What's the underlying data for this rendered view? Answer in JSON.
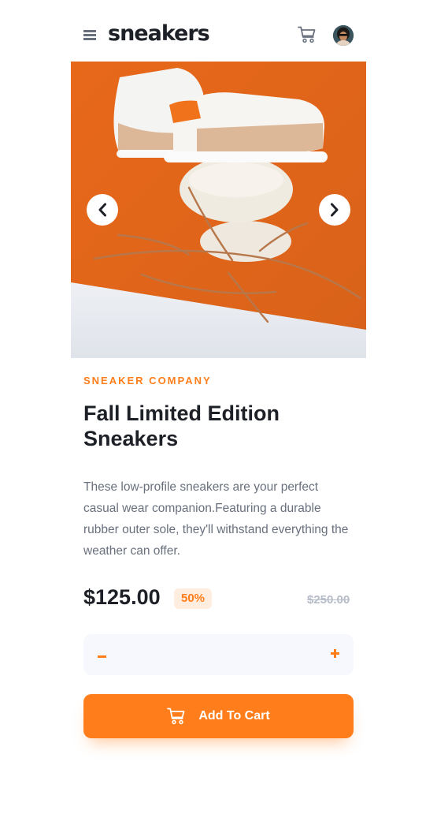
{
  "header": {
    "logo": "sneakers"
  },
  "product": {
    "company": "SNEAKER COMPANY",
    "title": "Fall Limited Edition Sneakers",
    "description": "These low-profile sneakers are your perfect casual wear companion.Featuring a durable rubber outer sole, they'll withstand everything the weather can offer.",
    "price": "$125.00",
    "discount": "50%",
    "old_price": "$250.00"
  },
  "quantity": {
    "value": ""
  },
  "cart_button": {
    "label": "Add To Cart"
  },
  "icons": {
    "menu": "menu-icon",
    "cart": "cart-icon",
    "prev": "chevron-left-icon",
    "next": "chevron-right-icon",
    "minus": "minus-icon",
    "plus": "plus-icon"
  },
  "colors": {
    "accent": "#ff7e1b",
    "accent_pale": "#ffede0",
    "text_dark": "#1d2026",
    "text_muted": "#69707d",
    "text_faded": "#b6bcc8",
    "surface": "#f6f8fd"
  }
}
